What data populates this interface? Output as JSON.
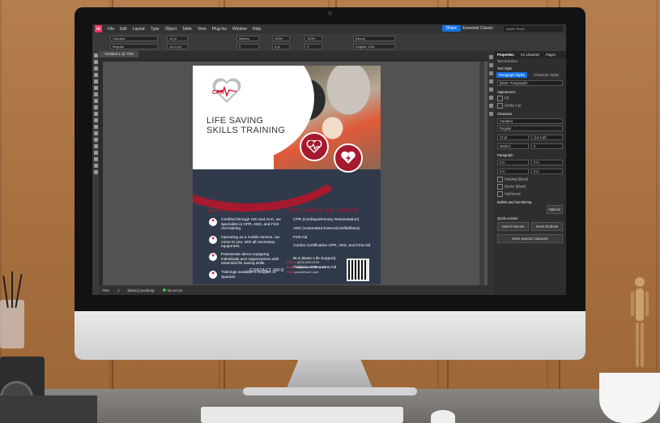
{
  "app": {
    "logo": "Id",
    "menu": [
      "File",
      "Edit",
      "Layout",
      "Type",
      "Object",
      "Table",
      "View",
      "Plug-Ins",
      "Window",
      "Help"
    ],
    "share": "Share",
    "workspace": "Essential Classic",
    "help_search_placeholder": "Adobe Stock"
  },
  "controlbar": {
    "font": "Candara",
    "style": "Regular",
    "size": "12 pt",
    "leading": "(14.4 pt)",
    "kerning": "Metrics",
    "tracking": "0",
    "scale_h": "100%",
    "scale_v": "100%",
    "baseline": "0 pt",
    "skew": "0°",
    "char_style": "[None]",
    "language": "English: USA"
  },
  "document": {
    "tab": "*Untitled-1 @ 75%"
  },
  "statusbar": {
    "zoom": "75%",
    "page": "1",
    "style": "[Basic] (working)",
    "errors": "No errors"
  },
  "panel": {
    "tabs": [
      "Properties",
      "CC Libraries",
      "Pages"
    ],
    "text_insertion": "Text Insertion",
    "text_style": "Text Style",
    "para_styles": "Paragraph Styles",
    "char_styles": "Character Styles",
    "basic_para": "[Basic Paragraph]+",
    "appearance": "Appearance",
    "fill": "Fill",
    "stroke": "Stroke",
    "stroke_weight": "0 pt",
    "character": "Character",
    "font": "Candara",
    "style": "Regular",
    "size": "12 pt",
    "leading": "(14.4 pt)",
    "kerning": "Metrics",
    "tracking": "0",
    "paragraph": "Paragraph",
    "indent": "0 in",
    "hyphenate": "Hyphenate",
    "shading": "Shading",
    "border": "Border",
    "black": "[Black]",
    "bullets": "Bullets and Numbering",
    "options": "Options",
    "quick_actions": "Quick Actions",
    "insert_footnote": "Insert Footnote",
    "insert_endnote": "Insert Endnote",
    "insert_special": "Insert Special Character"
  },
  "flyer": {
    "logo_text": "CPR",
    "headline": "LIFE SAVING SKILLS TRAINING",
    "who_title": "WHO WE ARE",
    "who_items": [
      "Certified through HSI and AHA, we specialize in CPR, AED, and First Aid training.",
      "Operating as a mobile service, we come to you, with all necessary equipment.",
      "Passionate about equipping individuals and organizations with essential life saving skills.",
      "Trainings available in English or Spanish."
    ],
    "offer_title": "TRAININGS WE OFFER",
    "offer_items": [
      "CPR (Cardiopulmonary Resuscitation)",
      "AED (Automated External Defibrillator)",
      "First Aid",
      "Combo Certification CPR, AED, and First Aid",
      "BLS (Basic Life Support)",
      "Pediatric CPR & First Aid"
    ],
    "contact_label": "CONTACT INFO",
    "phone_label": "Phone",
    "phone": "(800) 555-0199",
    "email_label": "Email",
    "email": "hi@cprandmore.com",
    "web_label": "Web",
    "web": "cprandmore.com"
  },
  "colors": {
    "brand_red": "#a6192e",
    "navy": "#313a4b",
    "accent_blue": "#1473e6"
  }
}
